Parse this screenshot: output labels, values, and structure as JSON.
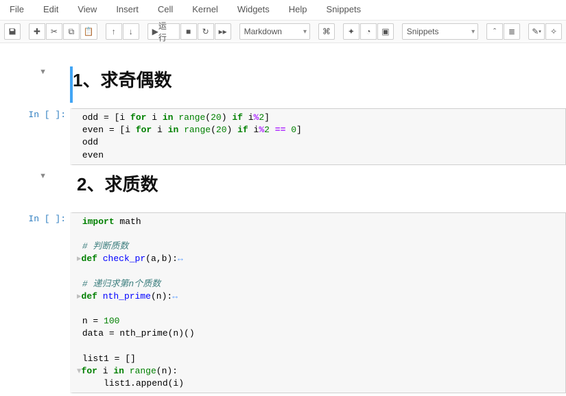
{
  "menu": [
    "File",
    "Edit",
    "View",
    "Insert",
    "Cell",
    "Kernel",
    "Widgets",
    "Help",
    "Snippets"
  ],
  "toolbar": {
    "run_label": "运行",
    "celltype_selected": "Markdown",
    "snippets_selected": "Snippets"
  },
  "cells": [
    {
      "type": "markdown",
      "selected": true,
      "collapsible": true,
      "heading": "1、求奇偶数"
    },
    {
      "type": "code",
      "prompt": "In [ ]:",
      "lines": [
        {
          "segs": [
            {
              "t": "odd = ["
            },
            {
              "t": "i "
            },
            {
              "t": "for",
              "c": "kw"
            },
            {
              "t": " i "
            },
            {
              "t": "in",
              "c": "kw"
            },
            {
              "t": " "
            },
            {
              "t": "range",
              "c": "bi"
            },
            {
              "t": "("
            },
            {
              "t": "20",
              "c": "num"
            },
            {
              "t": ") "
            },
            {
              "t": "if",
              "c": "kw"
            },
            {
              "t": " i"
            },
            {
              "t": "%",
              "c": "op"
            },
            {
              "t": "2",
              "c": "num"
            },
            {
              "t": "]"
            }
          ]
        },
        {
          "segs": [
            {
              "t": "even = [i "
            },
            {
              "t": "for",
              "c": "kw"
            },
            {
              "t": " i "
            },
            {
              "t": "in",
              "c": "kw"
            },
            {
              "t": " "
            },
            {
              "t": "range",
              "c": "bi"
            },
            {
              "t": "("
            },
            {
              "t": "20",
              "c": "num"
            },
            {
              "t": ") "
            },
            {
              "t": "if",
              "c": "kw"
            },
            {
              "t": " i"
            },
            {
              "t": "%",
              "c": "op"
            },
            {
              "t": "2",
              "c": "num"
            },
            {
              "t": " "
            },
            {
              "t": "==",
              "c": "op"
            },
            {
              "t": " "
            },
            {
              "t": "0",
              "c": "num"
            },
            {
              "t": "]"
            }
          ]
        },
        {
          "segs": [
            {
              "t": "odd"
            }
          ]
        },
        {
          "segs": [
            {
              "t": "even"
            }
          ]
        }
      ]
    },
    {
      "type": "markdown",
      "collapsible": true,
      "heading": "2、求质数"
    },
    {
      "type": "code",
      "prompt": "In [ ]:",
      "lines": [
        {
          "segs": [
            {
              "t": "import",
              "c": "kw"
            },
            {
              "t": " math"
            }
          ]
        },
        {
          "segs": [
            {
              "t": ""
            }
          ]
        },
        {
          "segs": [
            {
              "t": "# 判断质数",
              "c": "cm"
            }
          ]
        },
        {
          "gutter": "▸",
          "segs": [
            {
              "t": "def",
              "c": "kw"
            },
            {
              "t": " "
            },
            {
              "t": "check_pr",
              "c": "def"
            },
            {
              "t": "(a,b):"
            },
            {
              "t": "↔",
              "c": "fold"
            }
          ]
        },
        {
          "segs": [
            {
              "t": ""
            }
          ]
        },
        {
          "segs": [
            {
              "t": "# 递归求第n个质数",
              "c": "cm"
            }
          ]
        },
        {
          "gutter": "▸",
          "segs": [
            {
              "t": "def",
              "c": "kw"
            },
            {
              "t": " "
            },
            {
              "t": "nth_prime",
              "c": "def"
            },
            {
              "t": "(n):"
            },
            {
              "t": "↔",
              "c": "fold"
            }
          ]
        },
        {
          "segs": [
            {
              "t": ""
            }
          ]
        },
        {
          "segs": [
            {
              "t": "n = "
            },
            {
              "t": "100",
              "c": "num"
            }
          ]
        },
        {
          "segs": [
            {
              "t": "data = nth_prime(n)()"
            }
          ]
        },
        {
          "segs": [
            {
              "t": ""
            }
          ]
        },
        {
          "segs": [
            {
              "t": "list1 = []"
            }
          ]
        },
        {
          "gutter": "▾",
          "segs": [
            {
              "t": "for",
              "c": "kw"
            },
            {
              "t": " i "
            },
            {
              "t": "in",
              "c": "kw"
            },
            {
              "t": " "
            },
            {
              "t": "range",
              "c": "bi"
            },
            {
              "t": "(n):"
            }
          ]
        },
        {
          "segs": [
            {
              "t": "    list1.append(i)"
            }
          ]
        }
      ]
    }
  ]
}
